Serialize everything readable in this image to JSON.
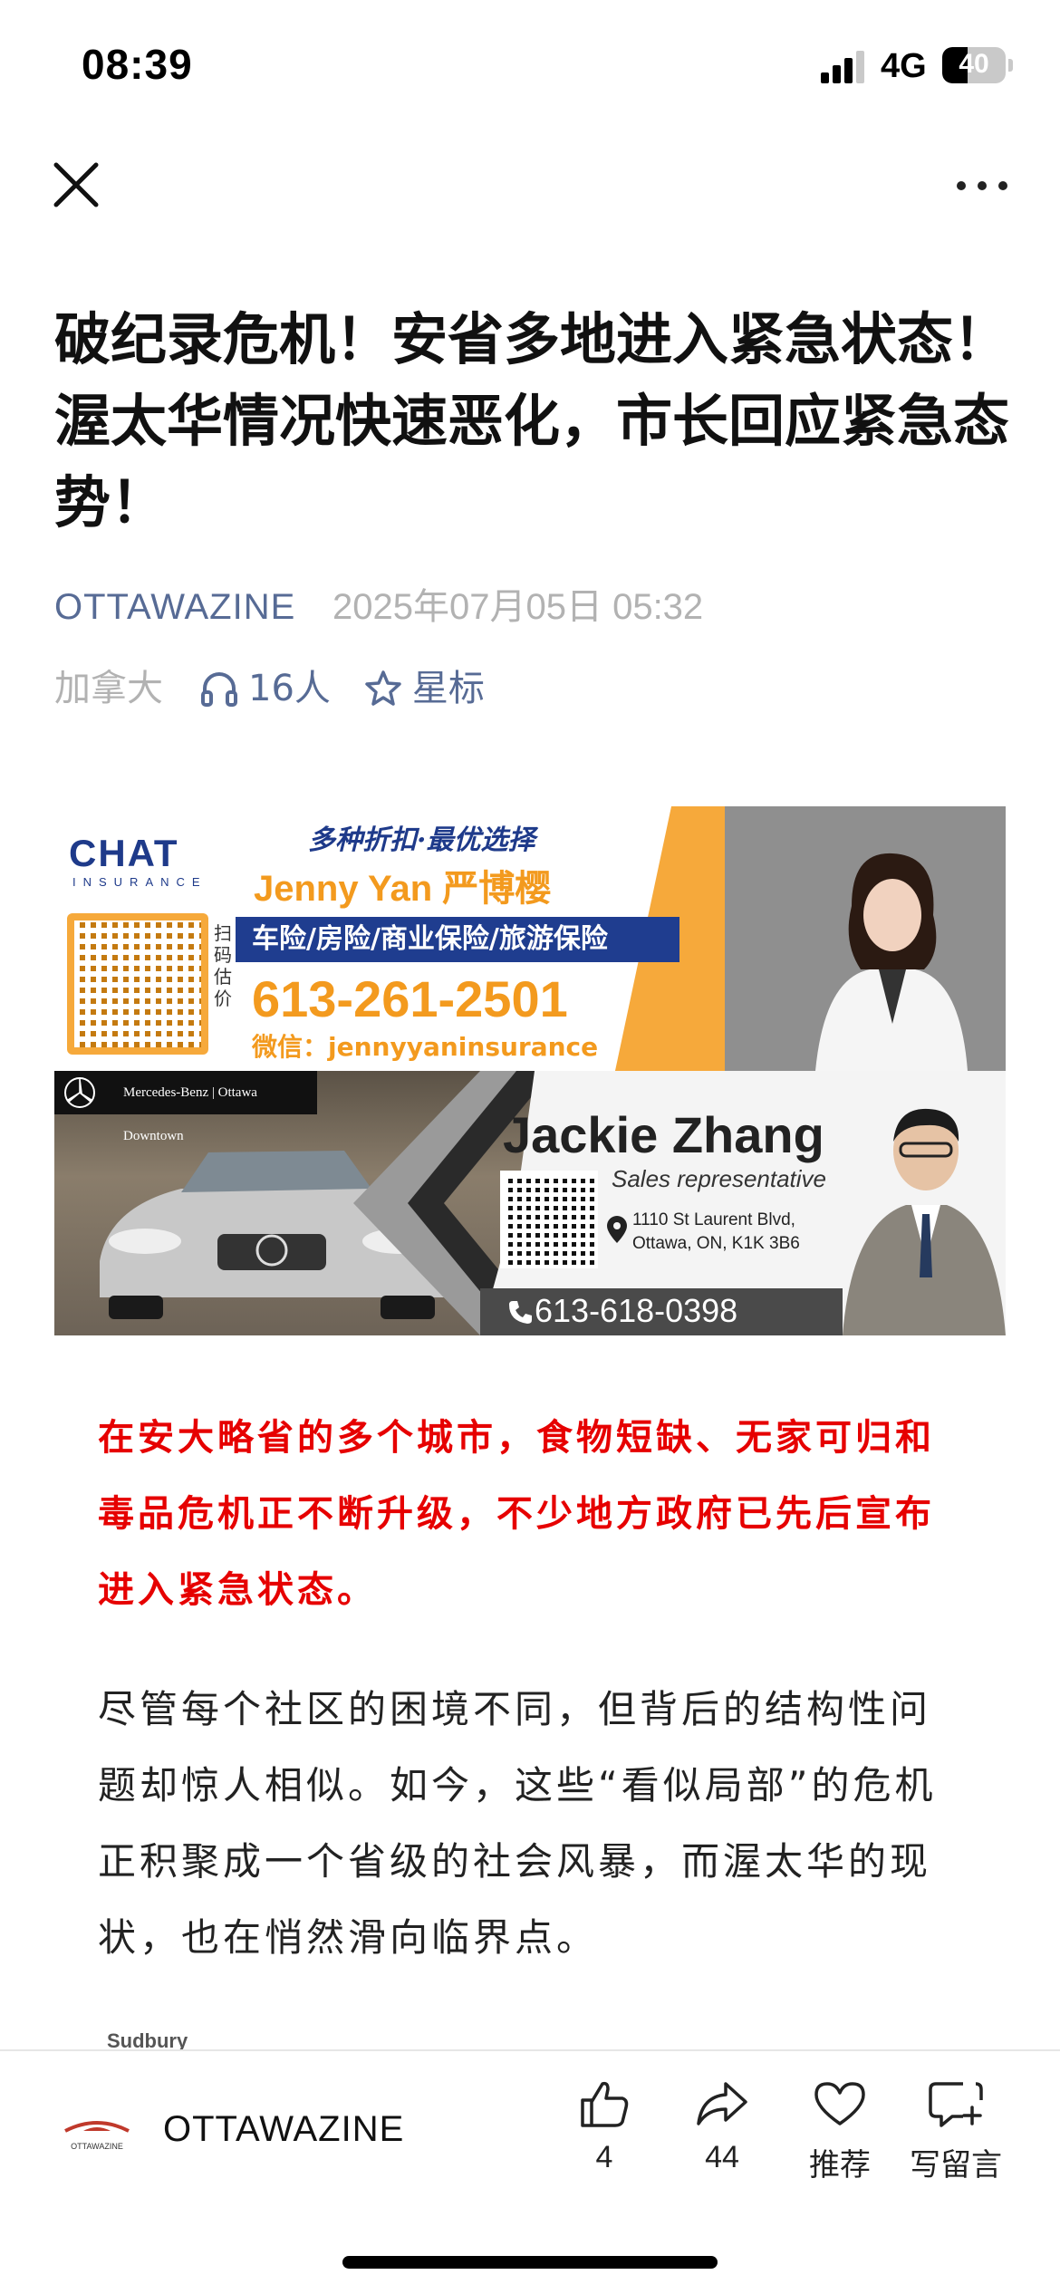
{
  "status_bar": {
    "time": "08:39",
    "network": "4G",
    "battery": "40",
    "battery_level": 0.4
  },
  "nav": {
    "close_icon": "close-icon",
    "more_icon": "more-icon"
  },
  "article": {
    "title": "破纪录危机！安省多地进入紧急状态！渥太华情况快速恶化，市长回应紧急态势！",
    "account": "OTTAWAZINE",
    "date": "2025年07月05日 05:32",
    "region": "加拿大",
    "listeners": "16人",
    "star_label": "星标",
    "lead": "在安大略省的多个城市，食物短缺、无家可归和毒品危机正不断升级，不少地方政府已先后宣布进入紧急状态。",
    "paragraph": "尽管每个社区的困境不同，但背后的结构性问题却惊人相似。如今，这些“看似局部”的危机正积聚成一个省级的社会风暴，而渥太华的现状，也在悄然滑向临界点。",
    "next_caption": "Sudbury"
  },
  "ad_insurance": {
    "logo": "CHAT",
    "logo_sub": "INSURANCE",
    "slogan": "多种折扣·最优选择",
    "name": "Jenny Yan 严博樱",
    "services": "车险/房险/商业保险/旅游保险",
    "scan_text": "扫码估价",
    "phone": "613-261-2501",
    "wechat": "微信：jennyyaninsurance"
  },
  "ad_mercedes": {
    "dealer": "Mercedes-Benz | Ottawa Downtown",
    "name": "Jackie Zhang",
    "role": "Sales representative",
    "address_line1": "1110 St Laurent Blvd,",
    "address_line2": "Ottawa, ON, K1K 3B6",
    "phone": "613-618-0398"
  },
  "bottom_bar": {
    "account": "OTTAWAZINE",
    "logo_text": "OTTAWAZINE",
    "like_count": "4",
    "share_count": "44",
    "recommend_label": "推荐",
    "comment_label": "写留言"
  },
  "colors": {
    "link_blue": "#576b95",
    "lead_red": "#e60000",
    "meta_grey": "#b2b2b2",
    "ad_orange": "#f6a93b",
    "ad_navy": "#1f3d8f"
  }
}
